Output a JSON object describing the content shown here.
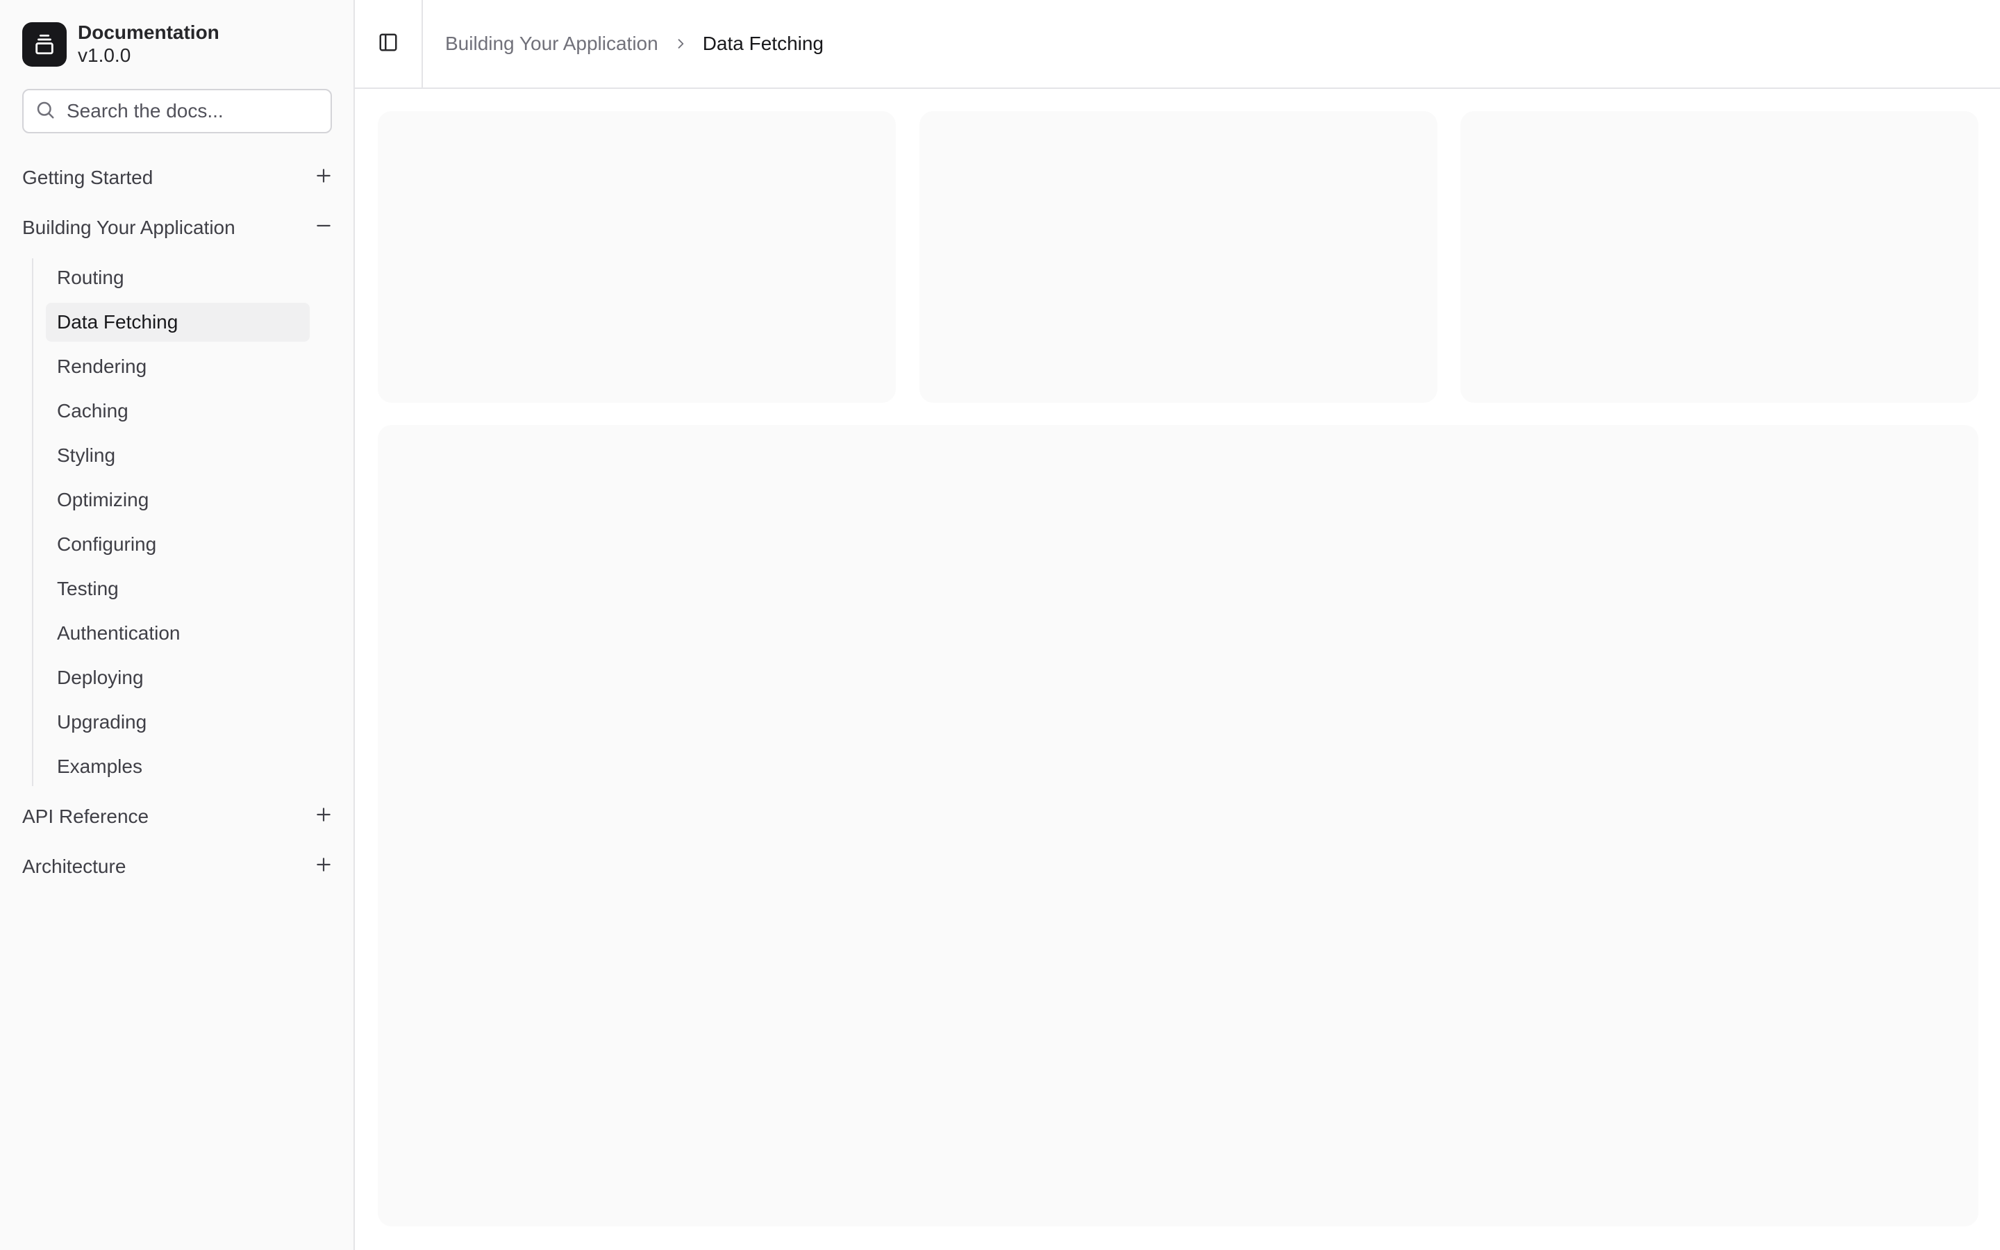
{
  "brand": {
    "title": "Documentation",
    "version": "v1.0.0",
    "logo_icon": "layers-icon"
  },
  "search": {
    "placeholder": "Search the docs..."
  },
  "nav": {
    "groups": [
      {
        "label": "Getting Started",
        "toggle": "plus-icon",
        "expanded": false
      },
      {
        "label": "Building Your Application",
        "toggle": "minus-icon",
        "expanded": true,
        "items": [
          {
            "label": "Routing"
          },
          {
            "label": "Data Fetching",
            "active": true
          },
          {
            "label": "Rendering"
          },
          {
            "label": "Caching"
          },
          {
            "label": "Styling"
          },
          {
            "label": "Optimizing"
          },
          {
            "label": "Configuring"
          },
          {
            "label": "Testing"
          },
          {
            "label": "Authentication"
          },
          {
            "label": "Deploying"
          },
          {
            "label": "Upgrading"
          },
          {
            "label": "Examples"
          }
        ]
      },
      {
        "label": "API Reference",
        "toggle": "plus-icon",
        "expanded": false
      },
      {
        "label": "Architecture",
        "toggle": "plus-icon",
        "expanded": false
      }
    ]
  },
  "header": {
    "sidebar_toggle_icon": "sidebar-toggle-icon",
    "breadcrumb": {
      "parent": "Building Your Application",
      "current": "Data Fetching",
      "separator_icon": "chevron-right-icon"
    }
  },
  "colors": {
    "sidebar_bg": "#fafafa",
    "placeholder_card": "#fafafa",
    "active_item_bg": "#f0f0f1",
    "logo_bg": "#18181b",
    "border": "#e4e4e7"
  }
}
